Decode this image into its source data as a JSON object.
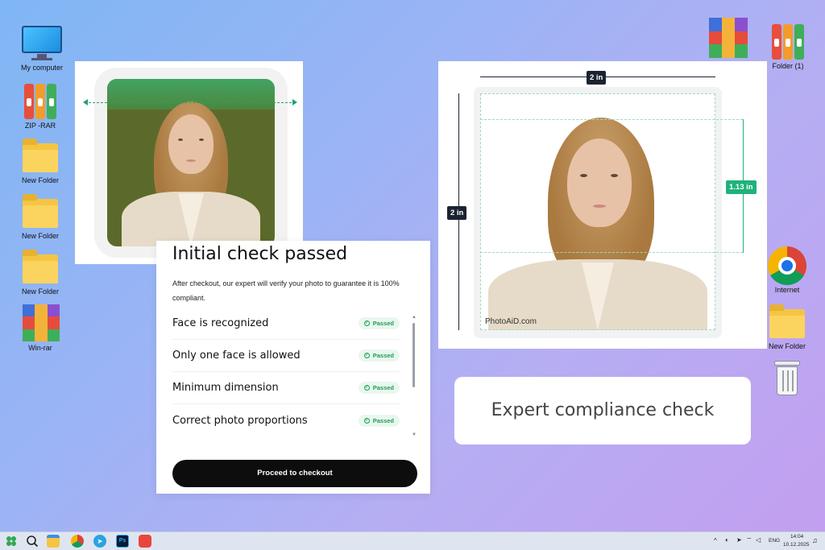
{
  "desktop_icons_left": [
    {
      "label": "My computer",
      "icon": "computer-icon"
    },
    {
      "label": "ZIP -RAR",
      "icon": "binders-icon"
    },
    {
      "label": "New Folder",
      "icon": "folder-icon"
    },
    {
      "label": "New Folder",
      "icon": "folder-icon"
    },
    {
      "label": "New Folder",
      "icon": "folder-icon"
    },
    {
      "label": "Win-rar",
      "icon": "winrar-icon"
    }
  ],
  "desktop_icons_right": [
    {
      "label": "",
      "icon": "winrar-icon"
    },
    {
      "label": "Folder (1)",
      "icon": "binders-icon"
    },
    {
      "label": "Internet",
      "icon": "chrome-icon"
    },
    {
      "label": "New Folder",
      "icon": "folder-icon"
    },
    {
      "label": "",
      "icon": "recycle-bin-icon"
    }
  ],
  "check_panel": {
    "title": "Initial check passed",
    "description": "After checkout, our expert will verify your photo to guarantee it is 100% compliant.",
    "items": [
      {
        "label": "Face is recognized",
        "status": "Passed"
      },
      {
        "label": "Only one face is allowed",
        "status": "Passed"
      },
      {
        "label": "Minimum dimension",
        "status": "Passed"
      },
      {
        "label": "Correct photo proportions",
        "status": "Passed"
      }
    ],
    "checkout_label": "Proceed to checkout"
  },
  "photo_spec": {
    "width_label": "2 in",
    "height_label": "2 in",
    "head_label": "1.13 in",
    "watermark": "PhotoAiD.com"
  },
  "expert_box": {
    "text": "Expert compliance check"
  },
  "taskbar": {
    "lang": "ENG",
    "time": "14:04",
    "date": "10.12.2025"
  },
  "colors": {
    "accent_green": "#1fb27a",
    "dark_label": "#1b2333",
    "button_black": "#0d0d0d"
  }
}
